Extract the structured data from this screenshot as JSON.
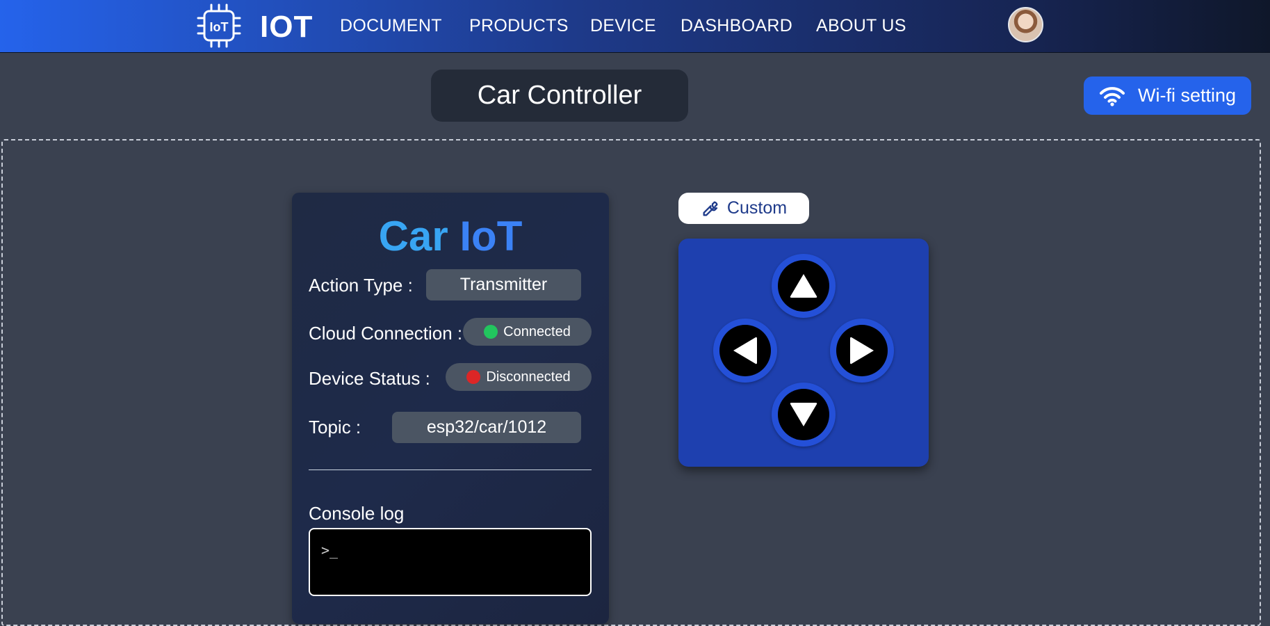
{
  "brand": "IOT",
  "logo_text": "IoT",
  "nav": [
    "DOCUMENT",
    "PRODUCTS",
    "DEVICE",
    "DASHBOARD",
    "ABOUT US"
  ],
  "page_title": "Car Controller",
  "wifi_button": "Wi-fi setting",
  "card": {
    "title_part1": "Car",
    "title_part2": "IoT",
    "action_type_label": "Action Type :",
    "action_type_value": "Transmitter",
    "cloud_label": "Cloud Connection :",
    "cloud_value": "Connected",
    "device_label": "Device Status :",
    "device_value": "Disconnected",
    "topic_label": "Topic :",
    "topic_value": "esp32/car/1012",
    "console_label": "Console log",
    "console_prompt": ">_"
  },
  "custom_button": "Custom",
  "colors": {
    "connected": "#22c55e",
    "disconnected": "#dc2626",
    "accent": "#2563eb"
  },
  "icons": {
    "wifi": "wifi-icon",
    "wrench": "wrench-icon",
    "up": "arrow-up-icon",
    "down": "arrow-down-icon",
    "left": "arrow-left-icon",
    "right": "arrow-right-icon"
  }
}
